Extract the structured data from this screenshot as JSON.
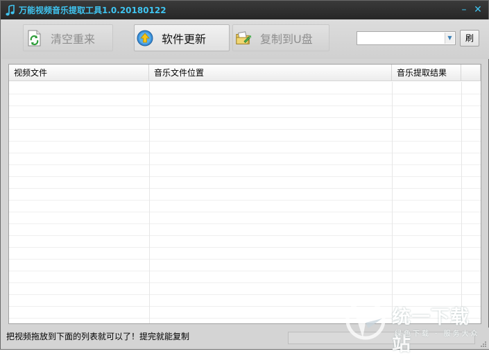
{
  "window": {
    "title": "万能视频音乐提取工具1.0.20180122",
    "minimize_glyph": "–",
    "close_glyph": "✕"
  },
  "toolbar": {
    "clear_label": "清空重来",
    "update_label": "软件更新",
    "copy_label": "复制到U盘",
    "clear_icon": "refresh-document-icon",
    "update_icon": "upload-arrow-icon",
    "copy_icon": "copy-folder-icon",
    "drive_select_value": "",
    "refresh_label": "刷"
  },
  "table": {
    "columns": [
      "视频文件",
      "音乐文件位置",
      "音乐提取结果",
      ""
    ],
    "rows": []
  },
  "status": {
    "message": "把视频拖放到下面的列表就可以了！提完就能复制"
  },
  "watermark": {
    "title": "统一下载站",
    "subtitle": "绿色下载 · 服务大众"
  },
  "colors": {
    "title_text": "#3fc4f0",
    "titlebar_bg": "#2e2e2e",
    "window_bg": "#d4d4d4"
  }
}
